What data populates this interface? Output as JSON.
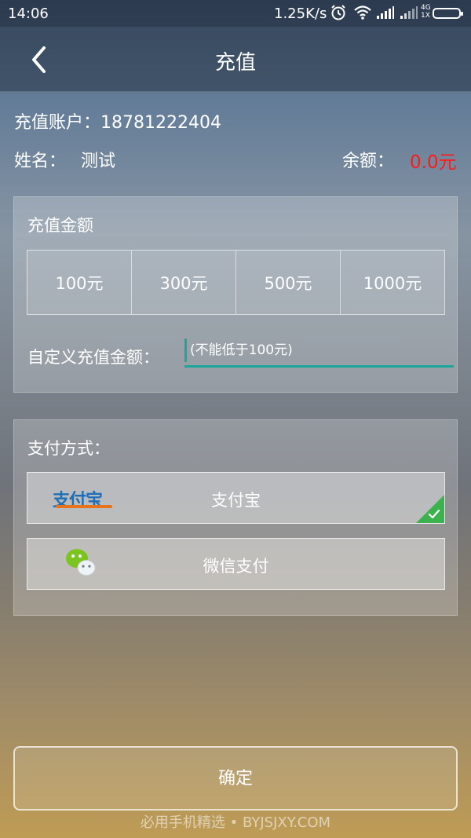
{
  "status_bar": {
    "time": "14:06",
    "speed": "1.25K/s",
    "network_type": "4G",
    "network_sub": "1X"
  },
  "header": {
    "title": "充值",
    "back_icon": "chevron-left-icon"
  },
  "account": {
    "account_text": "充值账户：18781222404",
    "name_label": "姓名：",
    "name_value": "测试",
    "balance_label": "余额：",
    "balance_value": "0.0元",
    "balance_color": "#ff1a1a"
  },
  "amount": {
    "title": "充值金额",
    "options": [
      "100元",
      "300元",
      "500元",
      "1000元"
    ],
    "custom_label": "自定义充值金额：",
    "custom_placeholder": "(不能低于100元)",
    "input_accent": "#1aa89a"
  },
  "payment": {
    "title": "支付方式：",
    "options": [
      {
        "label": "支付宝",
        "logo_text": "支付宝",
        "icon": "alipay-logo-icon",
        "selected": true
      },
      {
        "label": "微信支付",
        "icon": "wechat-logo-icon",
        "selected": false
      }
    ],
    "check_color": "#3bb24d"
  },
  "confirm_label": "确定",
  "watermark": "必用手机精选 • BYJSJXY.COM"
}
